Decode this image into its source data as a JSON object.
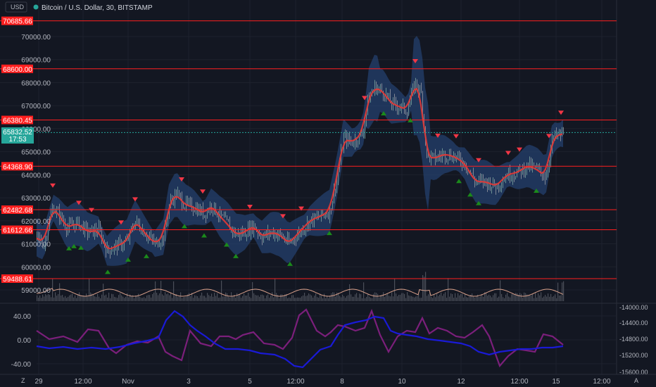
{
  "header": {
    "title": "Bitcoin / U.S. Dollar, 30, BITSTAMP",
    "currency": "USD"
  },
  "colors": {
    "background": "#131722",
    "level_line": "#ff1f1f",
    "price_line": "#e53935",
    "band": "#2a4a80",
    "osc_purple": "#7b1f7b",
    "osc_blue": "#1a1ad6",
    "volume": "#5d606b",
    "vol_ma": "#d8a08a",
    "badge_current": "#26a69a"
  },
  "price_axis": {
    "ticks": [
      "70000.00",
      "69000.00",
      "68000.00",
      "67000.00",
      "66000.00",
      "65000.00",
      "64000.00",
      "63000.00",
      "62000.00",
      "61000.00",
      "60000.00",
      "59000.00"
    ]
  },
  "levels": [
    {
      "label": "70685.66",
      "value": 70685.66
    },
    {
      "label": "68600.00",
      "value": 68600.0
    },
    {
      "label": "66380.45",
      "value": 66380.45
    },
    {
      "label": "64368.90",
      "value": 64368.9
    },
    {
      "label": "62482.68",
      "value": 62482.68
    },
    {
      "label": "61612.66",
      "value": 61612.66
    },
    {
      "label": "59488.61",
      "value": 59488.61
    }
  ],
  "current_price": {
    "price": "65832.52",
    "countdown": "17:53",
    "value": 65832.52
  },
  "osc_left_ticks": [
    "40.00",
    "0.00",
    "-40.00"
  ],
  "osc_right_ticks": [
    "-14000.00",
    "-14400.00",
    "-14800.00",
    "-15200.00",
    "-15600.00"
  ],
  "time_axis": {
    "labels": [
      "29",
      "12:00",
      "Nov",
      "3",
      "5",
      "12:00",
      "8",
      "10",
      "12",
      "12:00",
      "15",
      "12:00"
    ]
  },
  "corner": {
    "left": "Z",
    "right": "A"
  }
}
